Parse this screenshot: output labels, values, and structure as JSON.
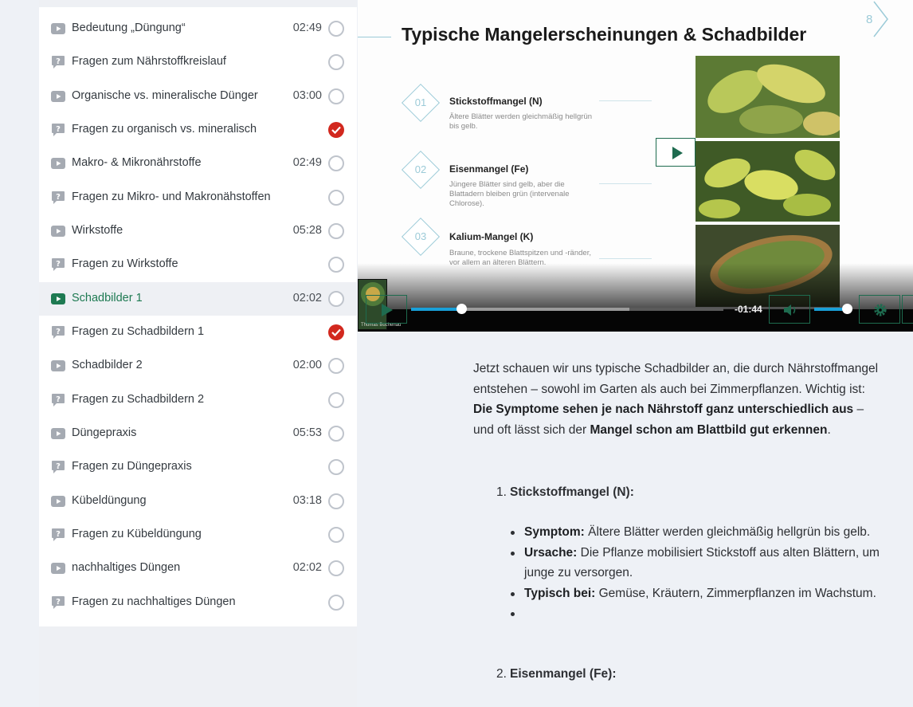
{
  "sidebar": {
    "lessons": [
      {
        "title": "Bedeutung „Düngung“",
        "type": "video",
        "duration": "02:49",
        "status": "open"
      },
      {
        "title": "Fragen zum Nährstoffkreislauf",
        "type": "quiz",
        "duration": "",
        "status": "open"
      },
      {
        "title": "Organische vs. mineralische Dünger",
        "type": "video",
        "duration": "03:00",
        "status": "open"
      },
      {
        "title": "Fragen zu organisch vs. mineralisch",
        "type": "quiz",
        "duration": "",
        "status": "done"
      },
      {
        "title": "Makro- & Mikronährstoffe",
        "type": "video",
        "duration": "02:49",
        "status": "open"
      },
      {
        "title": "Fragen zu Mikro- und Makronähstoffen",
        "type": "quiz",
        "duration": "",
        "status": "open"
      },
      {
        "title": "Wirkstoffe",
        "type": "video",
        "duration": "05:28",
        "status": "open"
      },
      {
        "title": "Fragen zu Wirkstoffe",
        "type": "quiz",
        "duration": "",
        "status": "open"
      },
      {
        "title": "Schadbilder 1",
        "type": "video",
        "duration": "02:02",
        "status": "open",
        "active": true
      },
      {
        "title": "Fragen zu Schadbildern 1",
        "type": "quiz",
        "duration": "",
        "status": "done"
      },
      {
        "title": "Schadbilder 2",
        "type": "video",
        "duration": "02:00",
        "status": "open"
      },
      {
        "title": "Fragen zu Schadbildern 2",
        "type": "quiz",
        "duration": "",
        "status": "open"
      },
      {
        "title": "Düngepraxis",
        "type": "video",
        "duration": "05:53",
        "status": "open"
      },
      {
        "title": "Fragen zu Düngepraxis",
        "type": "quiz",
        "duration": "",
        "status": "open"
      },
      {
        "title": "Kübeldüngung",
        "type": "video",
        "duration": "03:18",
        "status": "open"
      },
      {
        "title": "Fragen zu Kübeldüngung",
        "type": "quiz",
        "duration": "",
        "status": "open"
      },
      {
        "title": "nachhaltiges Düngen",
        "type": "video",
        "duration": "02:02",
        "status": "open"
      },
      {
        "title": "Fragen zu nachhaltiges Düngen",
        "type": "quiz",
        "duration": "",
        "status": "open"
      }
    ]
  },
  "video": {
    "slide_number": "8",
    "slide_title": "Typische Mangelerscheinungen & Schadbilder",
    "items": [
      {
        "num": "01",
        "title": "Stickstoffmangel (N)",
        "desc": "Ältere Blätter werden gleichmäßig hellgrün bis gelb."
      },
      {
        "num": "02",
        "title": "Eisenmangel (Fe)",
        "desc": "Jüngere Blätter sind gelb, aber die Blattadern bleiben grün (intervenale Chlorose)."
      },
      {
        "num": "03",
        "title": "Kalium-Mangel (K)",
        "desc": "Braune, trockene Blattspitzen und -ränder, vor allem an älteren Blättern."
      }
    ],
    "channel_name": "Thomas Buchenau",
    "time_remaining": "-01:44",
    "progress": 0.16,
    "buffered": 0.7,
    "volume": 0.85
  },
  "content": {
    "intro_plain_1": "Jetzt schauen wir uns typische Schadbilder an, die durch Nährstoffmangel entstehen – sowohl im Garten als auch bei Zimmerpflanzen. Wichtig ist: ",
    "intro_bold_1": "Die Symptome sehen je nach Nährstoff ganz unterschiedlich aus",
    "intro_plain_2": " – und oft lässt sich der ",
    "intro_bold_2": "Mangel schon am Blattbild gut erkennen",
    "intro_plain_3": ".",
    "section_1": {
      "num": "1.",
      "title": "Stickstoffmangel (N):"
    },
    "bullets": [
      {
        "label": "Symptom:",
        "text": " Ältere Blätter werden gleichmäßig hellgrün bis gelb."
      },
      {
        "label": "Ursache:",
        "text": " Die Pflanze mobilisiert Stickstoff aus alten Blättern, um junge zu versorgen."
      },
      {
        "label": "Typisch bei:",
        "text": " Gemüse, Kräutern, Zimmerpflanzen im Wachstum."
      }
    ],
    "section_2": {
      "num": "2.",
      "title": "Eisenmangel (Fe):"
    }
  },
  "colors": {
    "accent_green": "#1e7a52",
    "done_red": "#d2281e",
    "seek_blue": "#19a0d8",
    "slide_teal": "#9ccbd8"
  }
}
